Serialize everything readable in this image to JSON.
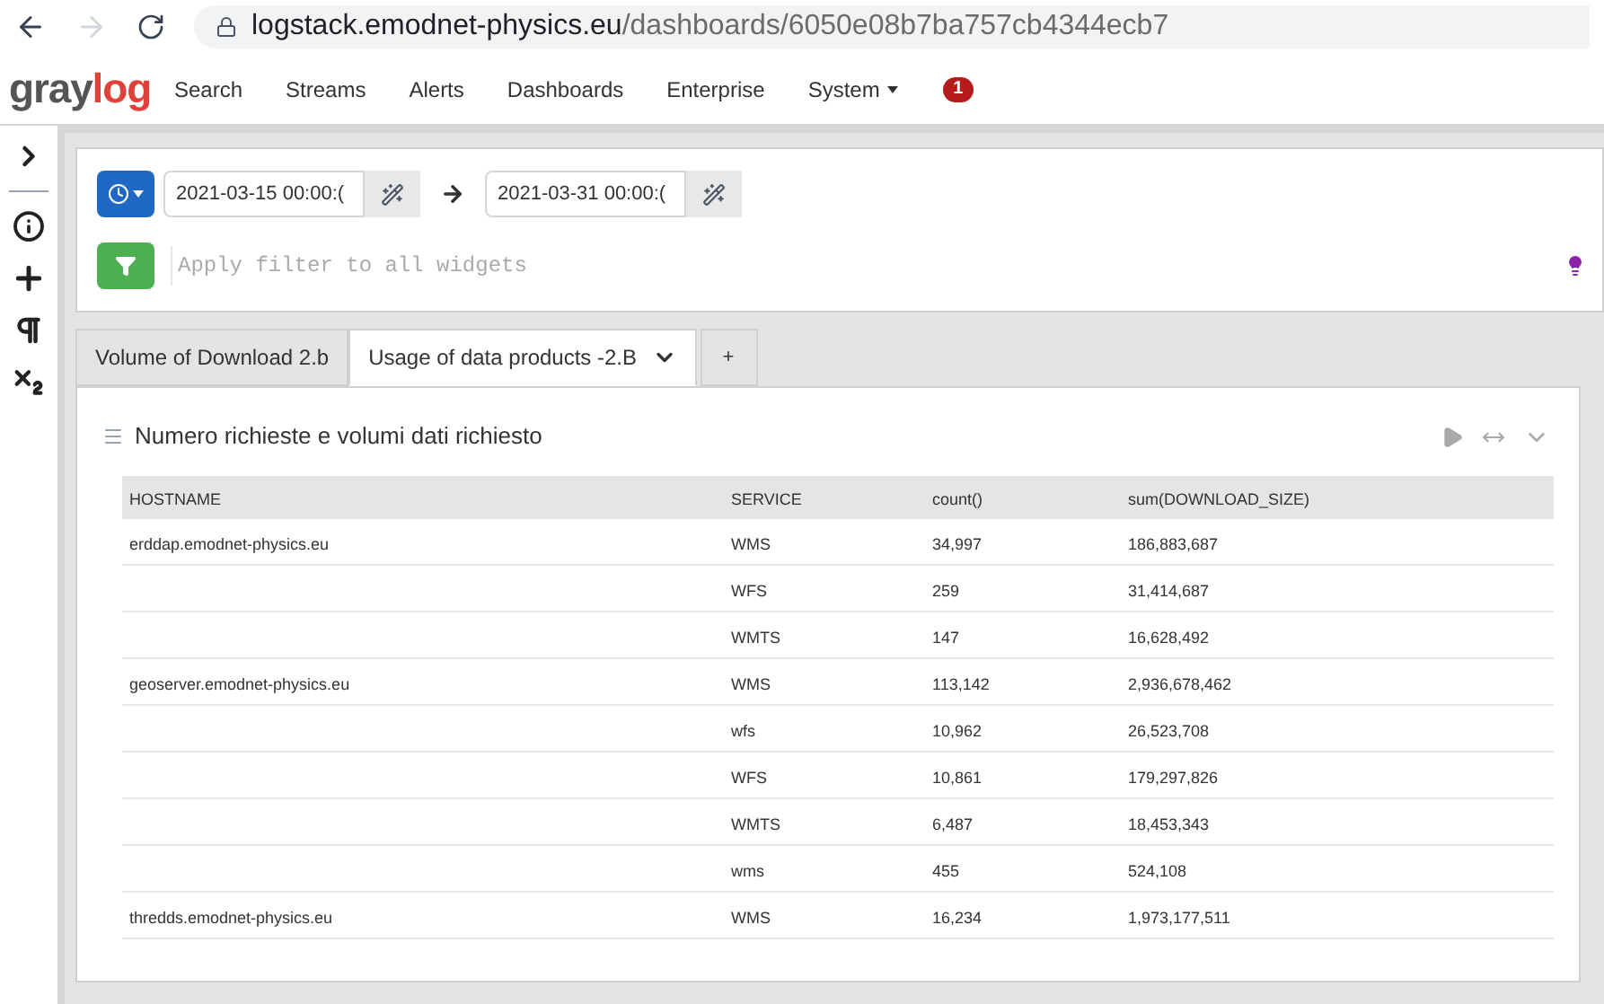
{
  "browser": {
    "url_host": "logstack.emodnet-physics.eu",
    "url_path": "/dashboards/6050e08b7ba757cb4344ecb7"
  },
  "nav": {
    "logo_gray": "gray",
    "logo_red": "log",
    "items": [
      {
        "label": "Search",
        "dropdown": false
      },
      {
        "label": "Streams",
        "dropdown": false
      },
      {
        "label": "Alerts",
        "dropdown": false
      },
      {
        "label": "Dashboards",
        "dropdown": false
      },
      {
        "label": "Enterprise",
        "dropdown": false
      },
      {
        "label": "System",
        "dropdown": true
      }
    ],
    "badge": "1"
  },
  "query": {
    "from": "2021-03-15 00:00:(",
    "to": "2021-03-31 00:00:(",
    "filter_placeholder": "Apply filter to all widgets"
  },
  "tabs": [
    {
      "label": "Volume of Download 2.b",
      "selected": false
    },
    {
      "label": "Usage of data products -2.B",
      "selected": true
    }
  ],
  "add_tab": "+",
  "widget": {
    "title": "Numero richieste e volumi dati richiesto",
    "table": {
      "columns": [
        "HOSTNAME",
        "SERVICE",
        "count()",
        "sum(DOWNLOAD_SIZE)"
      ],
      "rows": [
        [
          "erddap.emodnet-physics.eu",
          "WMS",
          "34,997",
          "186,883,687"
        ],
        [
          "",
          "WFS",
          "259",
          "31,414,687"
        ],
        [
          "",
          "WMTS",
          "147",
          "16,628,492"
        ],
        [
          "geoserver.emodnet-physics.eu",
          "WMS",
          "113,142",
          "2,936,678,462"
        ],
        [
          "",
          "wfs",
          "10,962",
          "26,523,708"
        ],
        [
          "",
          "WFS",
          "10,861",
          "179,297,826"
        ],
        [
          "",
          "WMTS",
          "6,487",
          "18,453,343"
        ],
        [
          "",
          "wms",
          "455",
          "524,108"
        ],
        [
          "thredds.emodnet-physics.eu",
          "WMS",
          "16,234",
          "1,973,177,511"
        ]
      ]
    }
  }
}
